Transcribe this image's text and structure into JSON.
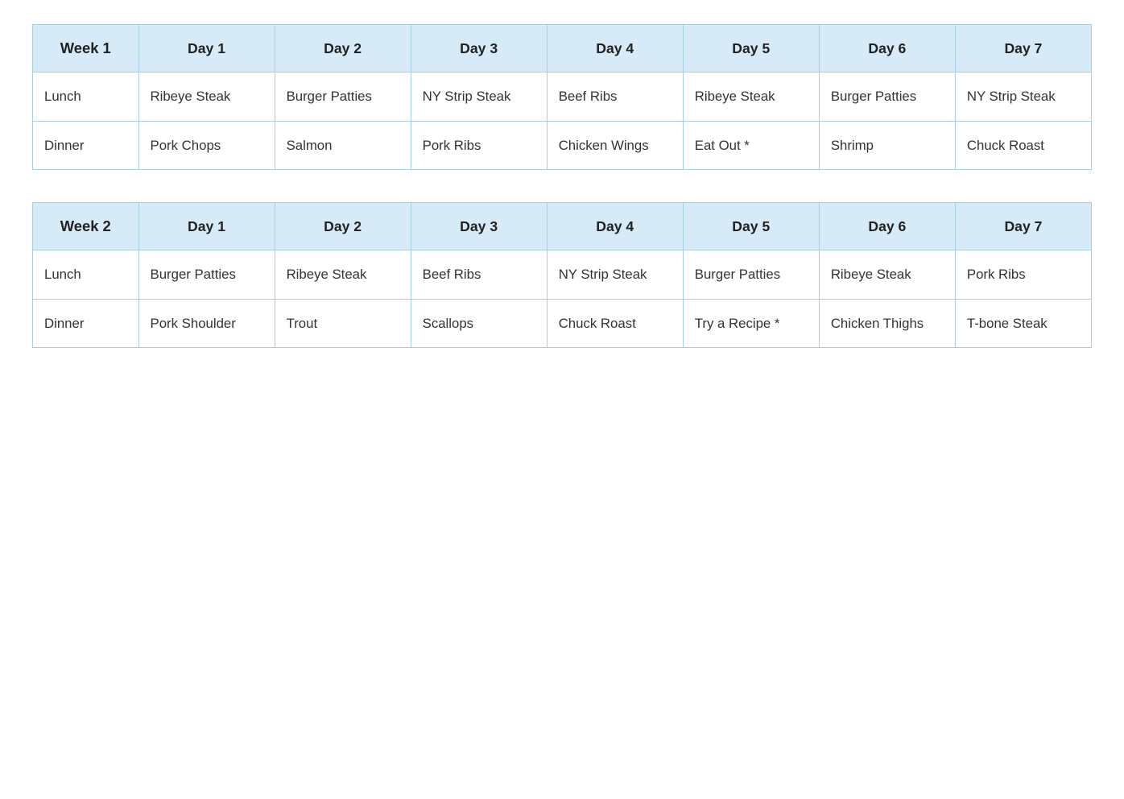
{
  "tables": [
    {
      "id": "week1",
      "week_label": "Week 1",
      "days": [
        "Day 1",
        "Day 2",
        "Day 3",
        "Day 4",
        "Day 5",
        "Day 6",
        "Day 7"
      ],
      "rows": [
        {
          "label": "Lunch",
          "cells": [
            "Ribeye Steak",
            "Burger Patties",
            "NY Strip Steak",
            "Beef Ribs",
            "Ribeye Steak",
            "Burger Patties",
            "NY Strip Steak"
          ]
        },
        {
          "label": "Dinner",
          "cells": [
            "Pork Chops",
            "Salmon",
            "Pork Ribs",
            "Chicken Wings",
            "Eat Out *",
            "Shrimp",
            "Chuck Roast"
          ]
        }
      ]
    },
    {
      "id": "week2",
      "week_label": "Week 2",
      "days": [
        "Day 1",
        "Day 2",
        "Day 3",
        "Day 4",
        "Day 5",
        "Day 6",
        "Day 7"
      ],
      "rows": [
        {
          "label": "Lunch",
          "cells": [
            "Burger Patties",
            "Ribeye Steak",
            "Beef Ribs",
            "NY Strip Steak",
            "Burger Patties",
            "Ribeye Steak",
            "Pork Ribs"
          ]
        },
        {
          "label": "Dinner",
          "cells": [
            "Pork Shoulder",
            "Trout",
            "Scallops",
            "Chuck Roast",
            "Try a Recipe *",
            "Chicken Thighs",
            "T-bone Steak"
          ]
        }
      ]
    }
  ]
}
